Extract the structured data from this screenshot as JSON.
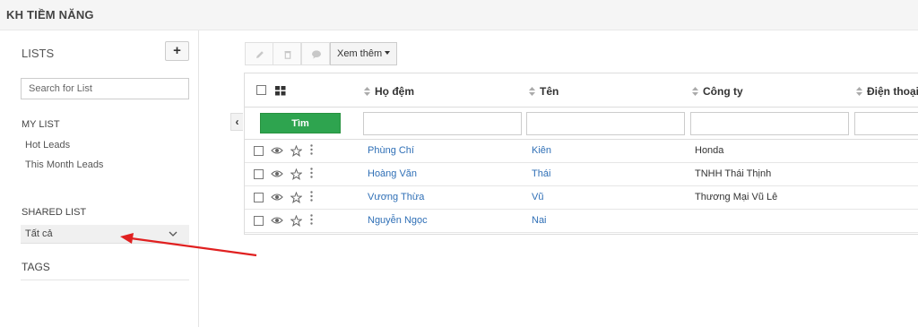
{
  "header": {
    "title": "KH TIỀM NĂNG"
  },
  "sidebar": {
    "lists_heading": "LISTS",
    "add_label": "+",
    "search_placeholder": "Search for List",
    "my_list_heading": "MY LIST",
    "my_list_items": [
      "Hot Leads",
      "This Month Leads"
    ],
    "shared_list_heading": "SHARED LIST",
    "shared_list_selected": "Tất cả",
    "tags_heading": "TAGS"
  },
  "toolbar": {
    "more_label": "Xem thêm",
    "icons": [
      "pencil-icon",
      "trash-icon",
      "comment-icon"
    ]
  },
  "grid": {
    "columns": [
      "Họ đệm",
      "Tên",
      "Công ty",
      "Điện thoại"
    ],
    "search_button": "Tìm",
    "rows": [
      {
        "ho_dem": "Phùng Chí",
        "ten": "Kiên",
        "cong_ty": "Honda",
        "dien_thoai": ""
      },
      {
        "ho_dem": "Hoàng Văn",
        "ten": "Thái",
        "cong_ty": "TNHH Thái Thịnh",
        "dien_thoai": ""
      },
      {
        "ho_dem": "Vương Thừa",
        "ten": "Vũ",
        "cong_ty": "Thương Mại Vũ Lê",
        "dien_thoai": ""
      },
      {
        "ho_dem": "Nguyễn Ngọc",
        "ten": "Nai",
        "cong_ty": "",
        "dien_thoai": ""
      }
    ]
  },
  "colors": {
    "accent_green": "#2ea44f",
    "link_blue": "#2f6fb6",
    "annotation_red": "#e02020"
  }
}
